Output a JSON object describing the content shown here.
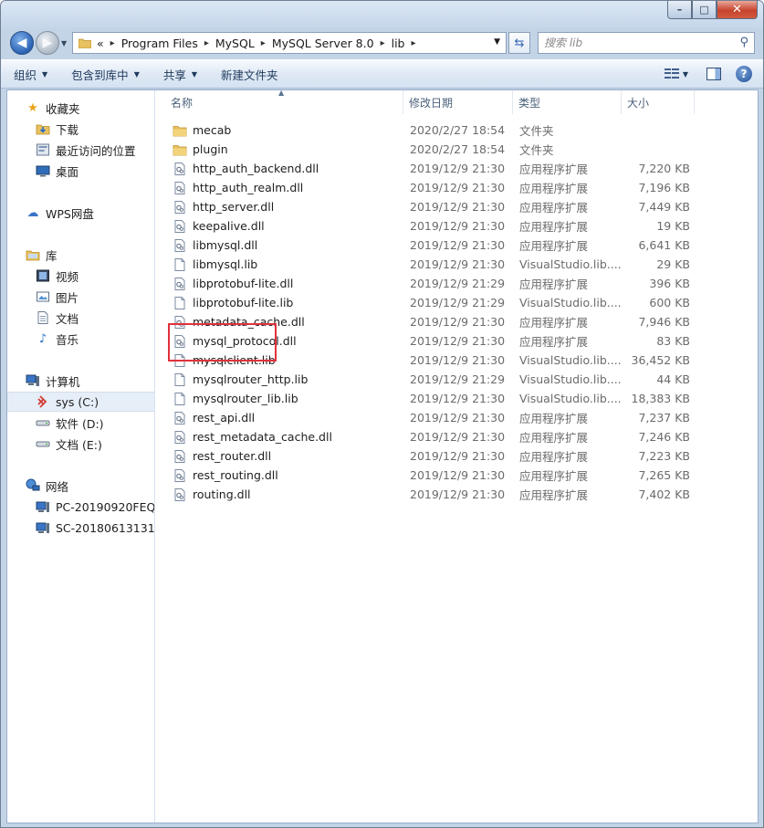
{
  "window": {
    "caption": {
      "min": "–",
      "max": "□",
      "close": "✕"
    }
  },
  "address": {
    "overflow": "«",
    "crumbs": [
      "Program Files",
      "MySQL",
      "MySQL Server 8.0",
      "lib"
    ]
  },
  "search": {
    "placeholder": "搜索 lib"
  },
  "toolbar": {
    "organize": "组织",
    "include_in_library": "包含到库中",
    "share": "共享",
    "new_folder": "新建文件夹"
  },
  "nav": {
    "favorites": "收藏夹",
    "downloads": "下载",
    "recent": "最近访问的位置",
    "desktop": "桌面",
    "wps": "WPS网盘",
    "libraries": "库",
    "videos": "视频",
    "pictures": "图片",
    "documents": "文档",
    "music": "音乐",
    "computer": "计算机",
    "drive_c": "sys (C:)",
    "drive_d": "软件 (D:)",
    "drive_e": "文档 (E:)",
    "network": "网络",
    "pc1": "PC-20190920FEQN",
    "pc2": "SC-201806131311"
  },
  "columns": {
    "name": "名称",
    "date": "修改日期",
    "type": "类型",
    "size": "大小"
  },
  "files": [
    {
      "name": "mecab",
      "date": "2020/2/27 18:54",
      "type": "文件夹",
      "size": "",
      "icon": "folder"
    },
    {
      "name": "plugin",
      "date": "2020/2/27 18:54",
      "type": "文件夹",
      "size": "",
      "icon": "folder"
    },
    {
      "name": "http_auth_backend.dll",
      "date": "2019/12/9 21:30",
      "type": "应用程序扩展",
      "size": "7,220 KB",
      "icon": "dll"
    },
    {
      "name": "http_auth_realm.dll",
      "date": "2019/12/9 21:30",
      "type": "应用程序扩展",
      "size": "7,196 KB",
      "icon": "dll"
    },
    {
      "name": "http_server.dll",
      "date": "2019/12/9 21:30",
      "type": "应用程序扩展",
      "size": "7,449 KB",
      "icon": "dll"
    },
    {
      "name": "keepalive.dll",
      "date": "2019/12/9 21:30",
      "type": "应用程序扩展",
      "size": "19 KB",
      "icon": "dll"
    },
    {
      "name": "libmysql.dll",
      "date": "2019/12/9 21:30",
      "type": "应用程序扩展",
      "size": "6,641 KB",
      "icon": "dll"
    },
    {
      "name": "libmysql.lib",
      "date": "2019/12/9 21:30",
      "type": "VisualStudio.lib....",
      "size": "29 KB",
      "icon": "file"
    },
    {
      "name": "libprotobuf-lite.dll",
      "date": "2019/12/9 21:29",
      "type": "应用程序扩展",
      "size": "396 KB",
      "icon": "dll"
    },
    {
      "name": "libprotobuf-lite.lib",
      "date": "2019/12/9 21:29",
      "type": "VisualStudio.lib....",
      "size": "600 KB",
      "icon": "file"
    },
    {
      "name": "metadata_cache.dll",
      "date": "2019/12/9 21:30",
      "type": "应用程序扩展",
      "size": "7,946 KB",
      "icon": "dll"
    },
    {
      "name": "mysql_protocol.dll",
      "date": "2019/12/9 21:30",
      "type": "应用程序扩展",
      "size": "83 KB",
      "icon": "dll"
    },
    {
      "name": "mysqlclient.lib",
      "date": "2019/12/9 21:30",
      "type": "VisualStudio.lib....",
      "size": "36,452 KB",
      "icon": "file"
    },
    {
      "name": "mysqlrouter_http.lib",
      "date": "2019/12/9 21:29",
      "type": "VisualStudio.lib....",
      "size": "44 KB",
      "icon": "file"
    },
    {
      "name": "mysqlrouter_lib.lib",
      "date": "2019/12/9 21:30",
      "type": "VisualStudio.lib....",
      "size": "18,383 KB",
      "icon": "file"
    },
    {
      "name": "rest_api.dll",
      "date": "2019/12/9 21:30",
      "type": "应用程序扩展",
      "size": "7,237 KB",
      "icon": "dll"
    },
    {
      "name": "rest_metadata_cache.dll",
      "date": "2019/12/9 21:30",
      "type": "应用程序扩展",
      "size": "7,246 KB",
      "icon": "dll"
    },
    {
      "name": "rest_router.dll",
      "date": "2019/12/9 21:30",
      "type": "应用程序扩展",
      "size": "7,223 KB",
      "icon": "dll"
    },
    {
      "name": "rest_routing.dll",
      "date": "2019/12/9 21:30",
      "type": "应用程序扩展",
      "size": "7,265 KB",
      "icon": "dll"
    },
    {
      "name": "routing.dll",
      "date": "2019/12/9 21:30",
      "type": "应用程序扩展",
      "size": "7,402 KB",
      "icon": "dll"
    }
  ],
  "colors": {
    "highlight": "#e0323a",
    "selected_nav": "#e6eef8",
    "toolbar_text": "#1e395b"
  }
}
